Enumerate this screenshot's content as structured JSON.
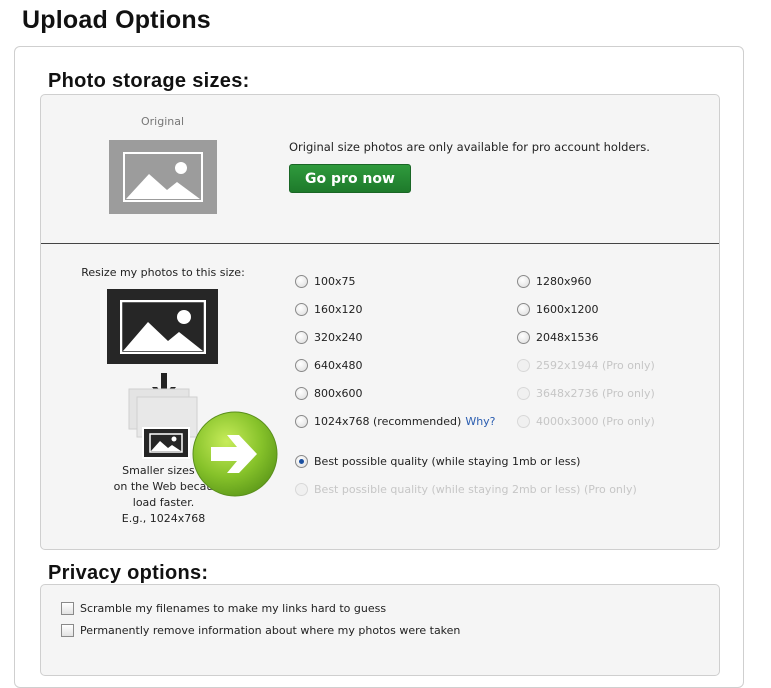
{
  "page": {
    "title": "Upload Options"
  },
  "storage": {
    "section_title": "Photo storage sizes:",
    "original_label": "Original",
    "pro_note": "Original size photos are only available for pro account holders.",
    "go_pro_label": "Go pro now",
    "resize_label": "Resize my photos to this size:",
    "caption_lines": [
      "Smaller sizes a",
      "on the Web becau",
      "load faster.",
      "E.g., 1024x768"
    ],
    "why_label": "Why?",
    "size_options_left": [
      {
        "label": "100x75",
        "disabled": false
      },
      {
        "label": "160x120",
        "disabled": false
      },
      {
        "label": "320x240",
        "disabled": false
      },
      {
        "label": "640x480",
        "disabled": false
      },
      {
        "label": "800x600",
        "disabled": false
      },
      {
        "label": "1024x768 (recommended)",
        "disabled": false
      }
    ],
    "size_options_right": [
      {
        "label": "1280x960",
        "disabled": false
      },
      {
        "label": "1600x1200",
        "disabled": false
      },
      {
        "label": "2048x1536",
        "disabled": false
      },
      {
        "label": "2592x1944 (Pro only)",
        "disabled": true
      },
      {
        "label": "3648x2736 (Pro only)",
        "disabled": true
      },
      {
        "label": "4000x3000 (Pro only)",
        "disabled": true
      }
    ],
    "quality_options": [
      {
        "label": "Best possible quality (while staying 1mb or less)",
        "selected": true,
        "disabled": false
      },
      {
        "label": "Best possible quality (while staying 2mb or less) (Pro only)",
        "selected": false,
        "disabled": true
      }
    ]
  },
  "privacy": {
    "section_title": "Privacy options:",
    "options": [
      {
        "label": "Scramble my filenames to make my links hard to guess",
        "checked": false
      },
      {
        "label": "Permanently remove information about where my photos were taken",
        "checked": false
      }
    ]
  },
  "colors": {
    "accent_green": "#2f9a3d",
    "link_blue": "#2a5db0",
    "selected_radio": "#1a4fa0"
  }
}
